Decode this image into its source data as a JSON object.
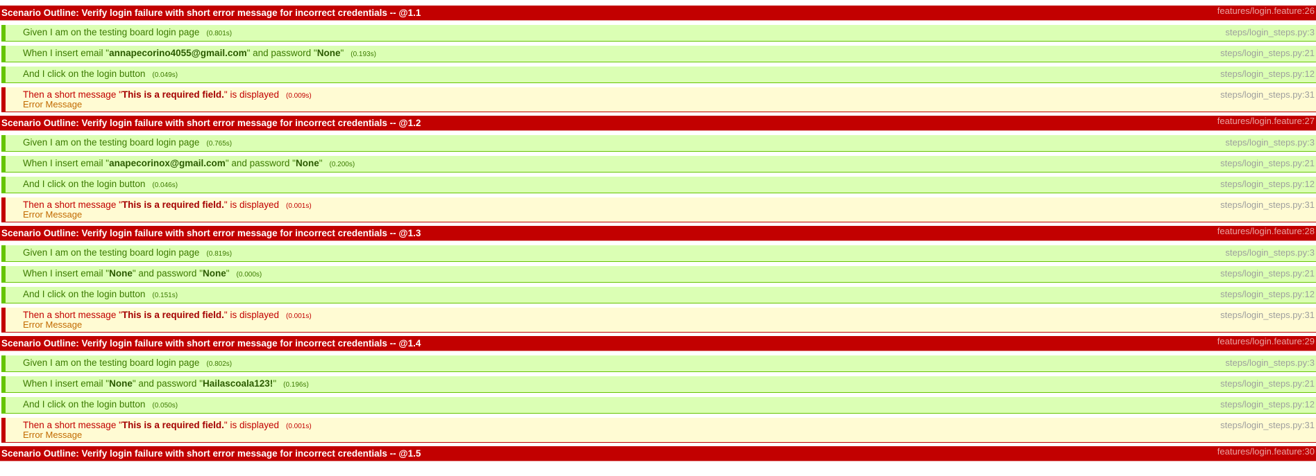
{
  "colors": {
    "scenario_failed": "#c20000",
    "step_passed_bg": "#dbffb4",
    "step_passed_border": "#65c400",
    "step_failed_bg": "#fffbd3",
    "step_failed_border": "#c20000"
  },
  "scenarios": [
    {
      "title": "Scenario Outline: Verify login failure with short error message for incorrect credentials -- @1.1",
      "location": "features/login.feature:26",
      "steps": [
        {
          "status": "passed",
          "prefix": "Given I am on the testing board login page",
          "duration": "(0.801s)",
          "location": "steps/login_steps.py:3"
        },
        {
          "status": "passed",
          "prefix": "When I insert email \"",
          "arg1": "annapecorino4055@gmail.com",
          "mid": "\" and password \"",
          "arg2": "None",
          "suffix": "\"",
          "duration": "(0.193s)",
          "location": "steps/login_steps.py:21"
        },
        {
          "status": "passed",
          "prefix": "And I click on the login button",
          "duration": "(0.049s)",
          "location": "steps/login_steps.py:12"
        },
        {
          "status": "failed",
          "prefix": "Then a short message \"",
          "arg1": "This is a required field.",
          "mid": "\" is displayed",
          "duration": "(0.009s)",
          "location": "steps/login_steps.py:31",
          "error": "Error Message"
        }
      ]
    },
    {
      "title": "Scenario Outline: Verify login failure with short error message for incorrect credentials -- @1.2",
      "location": "features/login.feature:27",
      "steps": [
        {
          "status": "passed",
          "prefix": "Given I am on the testing board login page",
          "duration": "(0.765s)",
          "location": "steps/login_steps.py:3"
        },
        {
          "status": "passed",
          "prefix": "When I insert email \"",
          "arg1": "anapecorinox@gmail.com",
          "mid": "\" and password \"",
          "arg2": "None",
          "suffix": "\"",
          "duration": "(0.200s)",
          "location": "steps/login_steps.py:21"
        },
        {
          "status": "passed",
          "prefix": "And I click on the login button",
          "duration": "(0.046s)",
          "location": "steps/login_steps.py:12"
        },
        {
          "status": "failed",
          "prefix": "Then a short message \"",
          "arg1": "This is a required field.",
          "mid": "\" is displayed",
          "duration": "(0.001s)",
          "location": "steps/login_steps.py:31",
          "error": "Error Message"
        }
      ]
    },
    {
      "title": "Scenario Outline: Verify login failure with short error message for incorrect credentials -- @1.3",
      "location": "features/login.feature:28",
      "steps": [
        {
          "status": "passed",
          "prefix": "Given I am on the testing board login page",
          "duration": "(0.819s)",
          "location": "steps/login_steps.py:3"
        },
        {
          "status": "passed",
          "prefix": "When I insert email \"",
          "arg1": "None",
          "mid": "\" and password \"",
          "arg2": "None",
          "suffix": "\"",
          "duration": "(0.000s)",
          "location": "steps/login_steps.py:21"
        },
        {
          "status": "passed",
          "prefix": "And I click on the login button",
          "duration": "(0.151s)",
          "location": "steps/login_steps.py:12"
        },
        {
          "status": "failed",
          "prefix": "Then a short message \"",
          "arg1": "This is a required field.",
          "mid": "\" is displayed",
          "duration": "(0.001s)",
          "location": "steps/login_steps.py:31",
          "error": "Error Message"
        }
      ]
    },
    {
      "title": "Scenario Outline: Verify login failure with short error message for incorrect credentials -- @1.4",
      "location": "features/login.feature:29",
      "steps": [
        {
          "status": "passed",
          "prefix": "Given I am on the testing board login page",
          "duration": "(0.802s)",
          "location": "steps/login_steps.py:3"
        },
        {
          "status": "passed",
          "prefix": "When I insert email \"",
          "arg1": "None",
          "mid": "\" and password \"",
          "arg2": "Hailascoala123!",
          "suffix": "\"",
          "duration": "(0.196s)",
          "location": "steps/login_steps.py:21"
        },
        {
          "status": "passed",
          "prefix": "And I click on the login button",
          "duration": "(0.050s)",
          "location": "steps/login_steps.py:12"
        },
        {
          "status": "failed",
          "prefix": "Then a short message \"",
          "arg1": "This is a required field.",
          "mid": "\" is displayed",
          "duration": "(0.001s)",
          "location": "steps/login_steps.py:31",
          "error": "Error Message"
        }
      ]
    },
    {
      "title": "Scenario Outline: Verify login failure with short error message for incorrect credentials -- @1.5",
      "location": "features/login.feature:30",
      "steps": []
    }
  ]
}
